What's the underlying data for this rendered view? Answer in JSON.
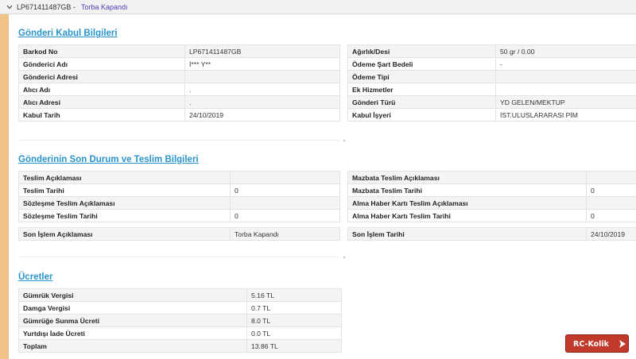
{
  "header": {
    "barcode": "LP671411487GB -",
    "status": "Torba Kapandı"
  },
  "kabul": {
    "title": "Gönderi Kabul Bilgileri",
    "left": [
      {
        "label": "Barkod No",
        "value": "LP671411487GB"
      },
      {
        "label": "Gönderici Adı",
        "value": "İ*** Y**"
      },
      {
        "label": "Gönderici Adresi",
        "value": ""
      },
      {
        "label": "Alıcı Adı",
        "value": "."
      },
      {
        "label": "Alıcı Adresi",
        "value": "."
      },
      {
        "label": "Kabul Tarih",
        "value": "24/10/2019"
      }
    ],
    "right": [
      {
        "label": "Ağırlık/Desi",
        "value": "50 gr / 0.00"
      },
      {
        "label": "Ödeme Şart Bedeli",
        "value": "-"
      },
      {
        "label": "Ödeme Tipi",
        "value": ""
      },
      {
        "label": "Ek Hizmetler",
        "value": ""
      },
      {
        "label": "Gönderi Türü",
        "value": "YD GELEN/MEKTUP"
      },
      {
        "label": "Kabul İşyeri",
        "value": "İST.ULUSLARARASI PİM"
      }
    ]
  },
  "teslim": {
    "title": "Gönderinin Son Durum ve Teslim Bilgileri",
    "left": [
      {
        "label": "Teslim Açıklaması",
        "value": ""
      },
      {
        "label": "Teslim Tarihi",
        "value": "0"
      },
      {
        "label": "Sözleşme Teslim Açıklaması",
        "value": ""
      },
      {
        "label": "Sözleşme Teslim Tarihi",
        "value": "0"
      }
    ],
    "right": [
      {
        "label": "Mazbata Teslim Açıklaması",
        "value": ""
      },
      {
        "label": "Mazbata Teslim Tarihi",
        "value": "0"
      },
      {
        "label": "Alma Haber Kartı Teslim Açıklaması",
        "value": ""
      },
      {
        "label": "Alma Haber Kartı Teslim Tarihi",
        "value": "0"
      }
    ],
    "son_islem_left": {
      "label": "Son İşlem Açıklaması",
      "value": "Torba Kapandı"
    },
    "son_islem_right": {
      "label": "Son İşlem Tarihi",
      "value": "24/10/2019"
    }
  },
  "ucretler": {
    "title": "Ücretler",
    "rows": [
      {
        "label": "Gümrük Vergisi",
        "value": "5.16 TL"
      },
      {
        "label": "Damga Vergisi",
        "value": "0.7 TL"
      },
      {
        "label": "Gümrüğe Sunma Ücreti",
        "value": "8.0 TL"
      },
      {
        "label": "Yurtdışı İade Ücreti",
        "value": "0.0 TL"
      },
      {
        "label": "Toplam",
        "value": "13.86 TL"
      }
    ]
  },
  "watermark": {
    "text": "RC-Kolik",
    "icon": "arrow-icon"
  },
  "colors": {
    "accent": "#f0c288",
    "link": "#2a93c9",
    "status": "#4a3fb5",
    "logo": "#c0392b"
  }
}
